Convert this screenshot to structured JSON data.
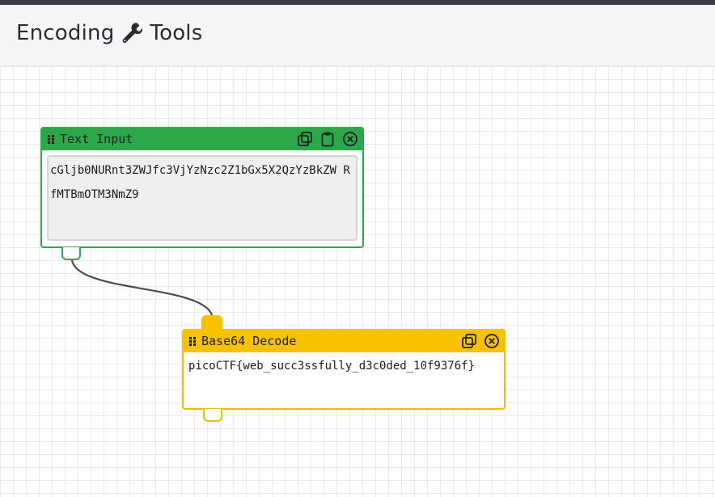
{
  "app": {
    "title": "Encoding",
    "title_suffix": "Tools",
    "title_icon": "wrench-icon"
  },
  "nodes": {
    "text_input": {
      "title": "Text Input",
      "value": "cGljb0NURnt3ZWJfc3VjYzNzc2Z1bGx5X2QzYzBkZW RfMTBmOTM3NmZ9",
      "actions": [
        "copy-icon",
        "clipboard-icon",
        "close-icon"
      ],
      "color": "#2aa84a"
    },
    "base64_decode": {
      "title": "Base64 Decode",
      "output": "picoCTF{web_succ3ssfully_d3c0ded_10f9376f}",
      "actions": [
        "copy-icon",
        "close-icon"
      ],
      "color": "#f8c200"
    }
  }
}
